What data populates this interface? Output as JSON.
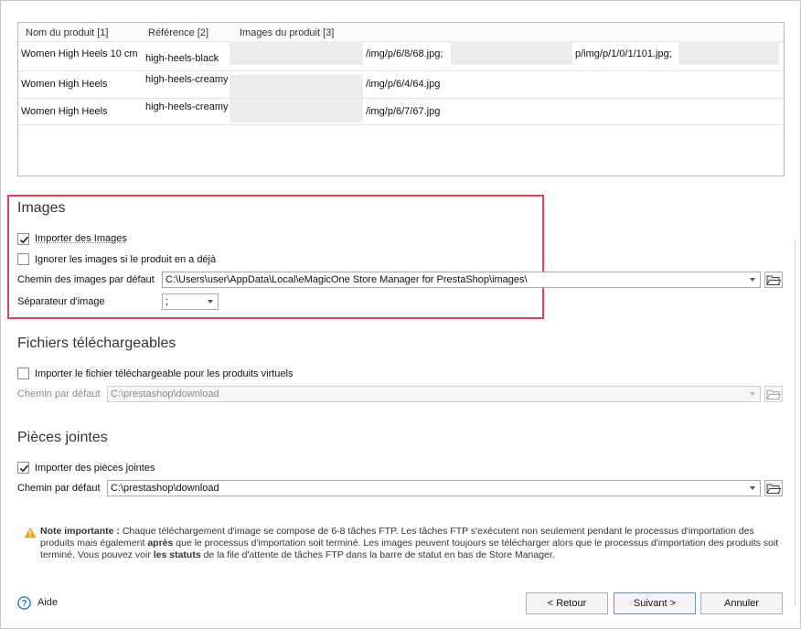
{
  "grid": {
    "columns": [
      "Nom du produit [1]",
      "Référence [2]",
      "Images du produit [3]"
    ],
    "rows": [
      {
        "name": "Women High Heels 10 cm",
        "ref": "high-heels-black",
        "img1": "/img/p/6/8/68.jpg;",
        "img2": "p/img/p/1/0/1/101.jpg;"
      },
      {
        "name": "Women High Heels",
        "ref": "high-heels-creamy",
        "img1": "/img/p/6/4/64.jpg",
        "img2": ""
      },
      {
        "name": "Women High Heels",
        "ref": "high-heels-creamy",
        "img1": "/img/p/6/7/67.jpg",
        "img2": ""
      }
    ]
  },
  "images": {
    "title": "Images",
    "import_label": "Importer des Images",
    "import_checked": true,
    "ignore_label": "Ignorer les images si le produit en a déjà",
    "ignore_checked": false,
    "path_label": "Chemin des images par défaut",
    "path_value": "C:\\Users\\user\\AppData\\Local\\eMagicOne Store Manager for PrestaShop\\images\\",
    "separator_label": "Séparateur d'image",
    "separator_value": ";"
  },
  "downloads": {
    "title": "Fichiers téléchargeables",
    "import_label": "Importer le fichier téléchargeable pour les produits virtuels",
    "import_checked": false,
    "path_label": "Chemin par défaut",
    "path_value": "C:\\prestashop\\download"
  },
  "attachments": {
    "title": "Pièces jointes",
    "import_label": "Importer des pièces jointes",
    "import_checked": true,
    "path_label": "Chemin par défaut",
    "path_value": "C:\\prestashop\\download"
  },
  "note": {
    "heading": "Note importante :",
    "text1": " Chaque téléchargement d'image se compose de 6-8 tâches FTP. Les tâches FTP s'exécutent non seulement pendant le processus d'importation des produits mais également ",
    "bold1": "après",
    "text2": " que le processus d'importation soit terminé. Les images peuvent toujours se télécharger alors que le processus d'importation des produits soit terminé. Vous pouvez voir ",
    "bold2": "les statuts",
    "text3": " de la file d'attente de tâches FTP dans la barre de statut en bas de Store Manager."
  },
  "footer": {
    "help": "Aide",
    "back": "< Retour",
    "next": "Suivant >",
    "cancel": "Annuler"
  },
  "icons": {
    "check": "checkmark-icon",
    "folder": "folder-open-icon",
    "warning": "warning-icon",
    "help": "help-icon"
  },
  "colors": {
    "highlight_border": "#e2404a",
    "warning": "#f0a020",
    "help": "#2d6fc2"
  }
}
